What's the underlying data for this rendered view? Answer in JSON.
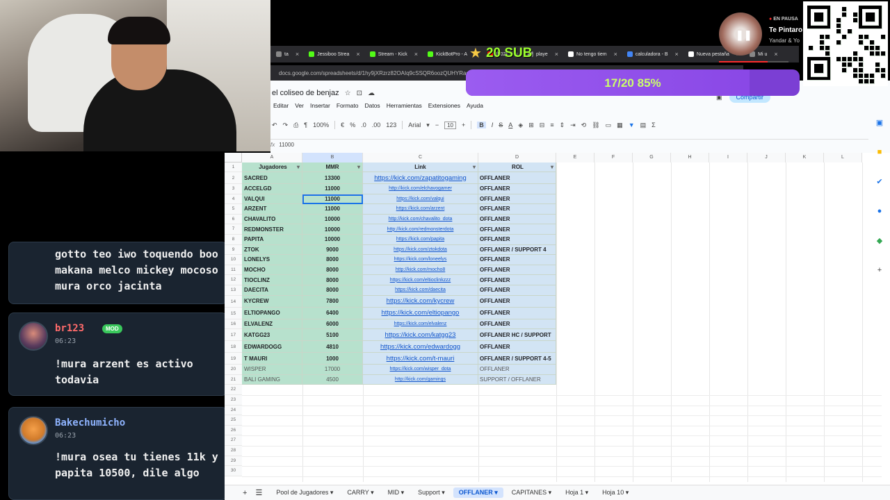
{
  "browser": {
    "tabs": [
      {
        "label": "ta",
        "color": "#888888"
      },
      {
        "label": "Jessiboo Strea",
        "color": "#53fc18"
      },
      {
        "label": "Stream - Kick",
        "color": "#53fc18"
      },
      {
        "label": "KickBotPro - A",
        "color": "#53fc18"
      },
      {
        "label": "(502)",
        "color": "#ff0000"
      },
      {
        "label": "playe",
        "color": "#888888"
      },
      {
        "label": "No tengo tiem",
        "color": "#ffffff"
      },
      {
        "label": "calculadora - B",
        "color": "#4285f4"
      },
      {
        "label": "Nueva pestaña",
        "color": "#ffffff"
      },
      {
        "label": "Mi u",
        "color": "#888888"
      }
    ],
    "url": "docs.google.com/spreadsheets/d/1hy9jXRzrz82OAIq9cSSQR6oozQUHYRagcXHCafH5"
  },
  "doc": {
    "title": "el coliseo de benjaz",
    "menu": [
      "Editar",
      "Ver",
      "Insertar",
      "Formato",
      "Datos",
      "Herramientas",
      "Extensiones",
      "Ayuda"
    ],
    "toolbar": {
      "zoom": "100%",
      "currency": "€",
      "percent": "%",
      "dec_less": ".0",
      "dec_more": ".00",
      "num_format": "123",
      "font": "Arial",
      "font_size": "10",
      "bold": "B",
      "italic": "I",
      "strike": "S",
      "text_color": "A",
      "sigma": "Σ"
    },
    "formula_value": "11000",
    "share_label": "Compartir"
  },
  "overlay": {
    "sub_goal": "20 SUB",
    "progress_label": "17/20 85%",
    "progress_fraction": 0.85,
    "music_status": "EN PAUSA",
    "song": "Te Pintaro",
    "artist": "Yandar & Yo"
  },
  "chat": {
    "msg1": {
      "text": "gotto teo iwo toquendo boo\nmakana melco mickey mocoso\nmura orco jacinta"
    },
    "msg2": {
      "user": "br123",
      "badge": "MOD",
      "time": "06:23",
      "text": "!mura arzent es activo\ntodavia",
      "name_color": "#ff6b6b"
    },
    "msg3": {
      "user": "Bakechumicho",
      "time": "06:23",
      "text": "!mura osea tu tienes 11k y\npapita 10500, dile algo",
      "name_color": "#8fb4ff"
    }
  },
  "sheet": {
    "columns": [
      "A",
      "B",
      "C",
      "D",
      "E",
      "F",
      "G",
      "H",
      "I",
      "J",
      "K",
      "L"
    ],
    "headers": [
      "Jugadores",
      "MMR",
      "Link",
      "ROL"
    ],
    "rows": [
      [
        "SACRED",
        "13300",
        "https://kick.com/zapatitogaming",
        "OFFLANER"
      ],
      [
        "ACCELGD",
        "11000",
        "http://kick.com/elchavogamer",
        "OFFLANER"
      ],
      [
        "VALQUI",
        "11000",
        "https://kick.com/valqui",
        "OFFLANER"
      ],
      [
        "ARZENT",
        "11000",
        "https://kick.com/arzent",
        "OFFLANER"
      ],
      [
        "CHAVALITO",
        "10000",
        "http://kick.com/chavalito_dota",
        "OFFLANER"
      ],
      [
        "REDMONSTER",
        "10000",
        "http://kick.com/redmonsterdota",
        "OFFLANER"
      ],
      [
        "PAPITA",
        "10000",
        "https://kick.com/papita",
        "OFFLANER"
      ],
      [
        "ZTOK",
        "9000",
        "https://kick.com/ztokdota",
        "OFFLANER / SUPPORT 4"
      ],
      [
        "LONELYS",
        "8000",
        "https://kick.com/loneelys",
        "OFFLANER"
      ],
      [
        "MOCHO",
        "8000",
        "http://kick.com/mocho8",
        "OFFLANER"
      ],
      [
        "TIOCLINZ",
        "8000",
        "https://kick.com/eltioclinkzzz",
        "OFFLANER"
      ],
      [
        "DAECITA",
        "8000",
        "https://kick.com/daecita",
        "OFFLANER"
      ],
      [
        "KYCREW",
        "7800",
        "https://kick.com/kycrew",
        "OFFLANER"
      ],
      [
        "ELTIOPANGO",
        "6400",
        "https://kick.com/eltiopango",
        "OFFLANER"
      ],
      [
        "ELVALENZ",
        "6000",
        "https://kick.com/elvalenz",
        "OFFLANER"
      ],
      [
        "KATGG23",
        "5100",
        "https://kick.com/katgg23",
        "OFFLANER HC / SUPPORT"
      ],
      [
        "EDWARDOGG",
        "4810",
        "https://kick.com/edwardogg",
        "OFFLANER"
      ],
      [
        "T MAURI",
        "1000",
        "https://kick.com/t-mauri",
        "OFFLANER / SUPPORT 4-5"
      ],
      [
        "WISPER",
        "17000",
        "https://kick.com/wisper_dota",
        "OFFLANER"
      ],
      [
        "BALI GAMING",
        "4500",
        "http://kick.com/gamings",
        "SUPPORT / OFFLANER"
      ]
    ],
    "empty_rows": [
      "22",
      "23",
      "24",
      "25",
      "26",
      "27",
      "28",
      "29",
      "30"
    ],
    "tabs": [
      "Pool de Jugadores",
      "CARRY",
      "MID",
      "Support",
      "OFFLANER",
      "CAPITANES",
      "Hoja 1",
      "Hoja 10"
    ],
    "active_tab": "OFFLANER"
  }
}
